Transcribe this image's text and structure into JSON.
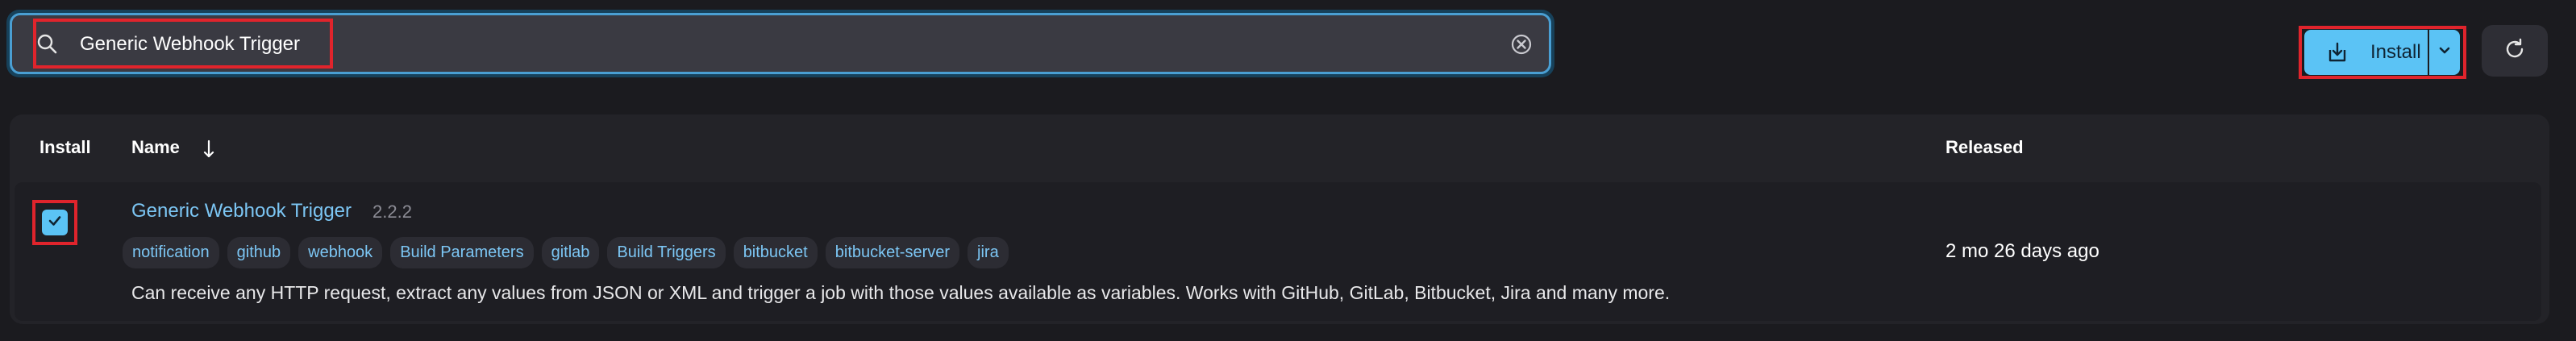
{
  "search": {
    "value": "Generic Webhook Trigger",
    "icon": "search-icon",
    "clear_icon": "clear-icon"
  },
  "toolbar": {
    "install_label": "Install",
    "install_icon": "download-icon",
    "split_icon": "chevron-down-icon",
    "refresh_icon": "refresh-icon",
    "accent_color": "#5bc3f5"
  },
  "table": {
    "headers": {
      "install": "Install",
      "name": "Name",
      "sort_icon": "arrow-down-icon",
      "released": "Released"
    },
    "rows": [
      {
        "checked": true,
        "name": "Generic Webhook Trigger",
        "version": "2.2.2",
        "tags": [
          "notification",
          "github",
          "webhook",
          "Build Parameters",
          "gitlab",
          "Build Triggers",
          "bitbucket",
          "bitbucket-server",
          "jira"
        ],
        "released": "2 mo 26 days ago",
        "description": "Can receive any HTTP request, extract any values from JSON or XML and trigger a job with those values available as variables. Works with GitHub, GitLab, Bitbucket, Jira and many more."
      }
    ]
  }
}
